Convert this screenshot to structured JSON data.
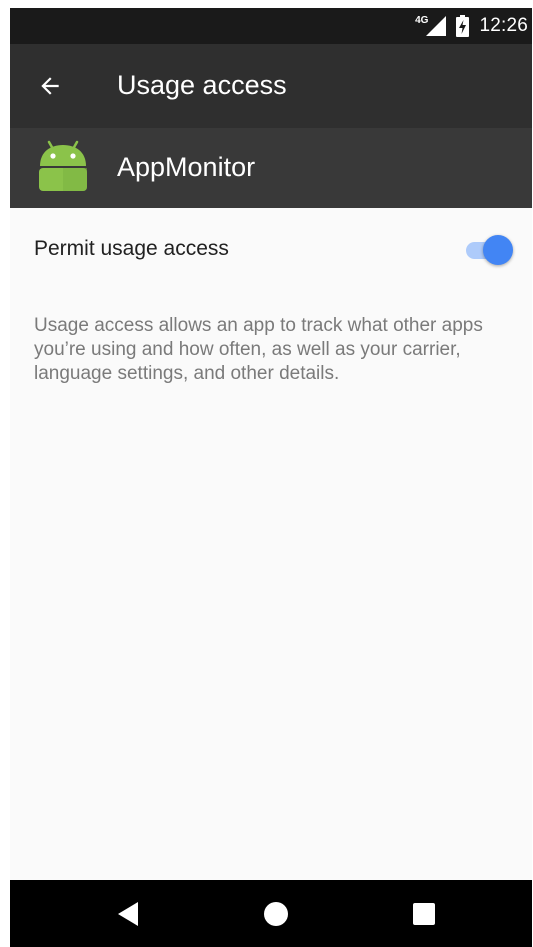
{
  "status_bar": {
    "network": "4G",
    "time": "12:26"
  },
  "toolbar": {
    "back_icon": "arrow-left-icon",
    "title": "Usage access"
  },
  "app": {
    "icon": "android-robot-icon",
    "name": "AppMonitor"
  },
  "setting": {
    "label": "Permit usage access",
    "enabled": true
  },
  "description": "Usage access allows an app to track what other apps you’re using and how often, as well as your carrier, language settings, and other details.",
  "nav_bar": {
    "back_icon": "nav-back-icon",
    "home_icon": "nav-home-icon",
    "recents_icon": "nav-recents-icon"
  },
  "colors": {
    "toolbar": "#2f2f2f",
    "app_header": "#393939",
    "accent": "#4285f4",
    "android_green": "#8bc34a"
  }
}
